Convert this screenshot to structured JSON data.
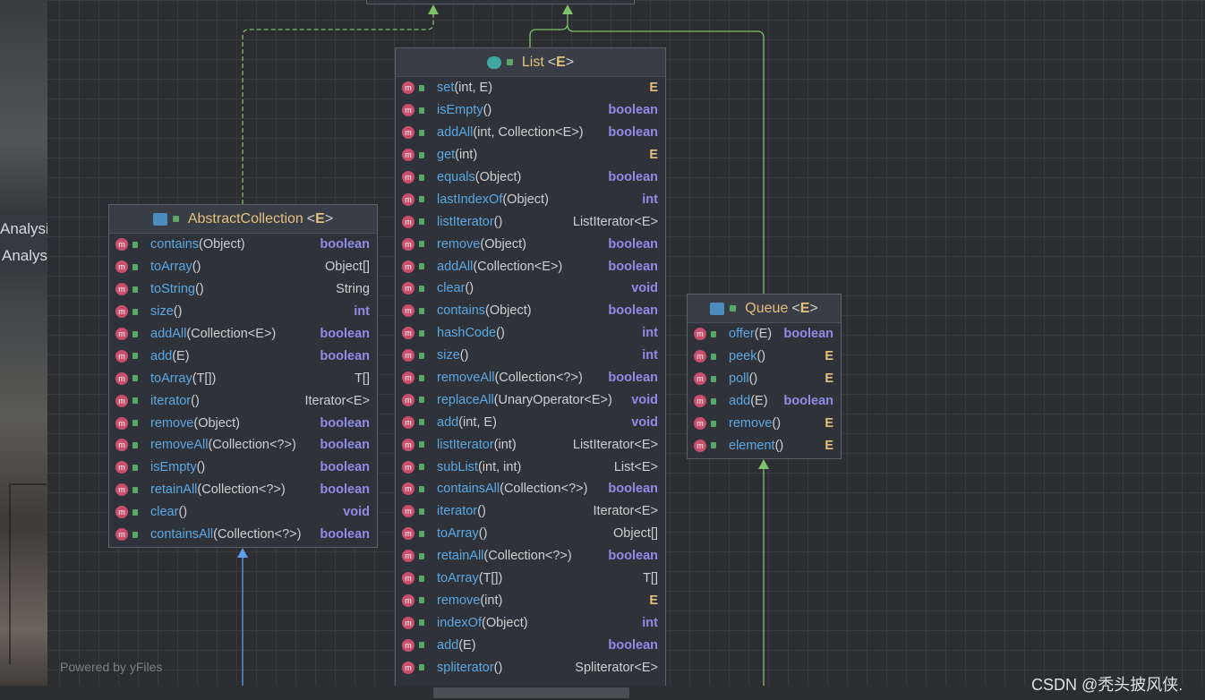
{
  "left_panel": {
    "lines": [
      "Analysi",
      "Analys"
    ]
  },
  "watermark": "Powered by yFiles",
  "credit": "CSDN @秃头披风侠.",
  "icons": {
    "method": "m-icon",
    "public": "lock-icon"
  },
  "colors": {
    "method_name": "#5aa9e6",
    "keyword": "#8f8ce8",
    "generic": "#e5c07b",
    "edge_green": "#7cc36b",
    "edge_blue": "#5aa0ee"
  },
  "nodes": {
    "abstract_collection": {
      "name": "AbstractCollection",
      "generic": "E",
      "methods": [
        {
          "name": "contains",
          "params": "(Object)",
          "type": "boolean"
        },
        {
          "name": "toArray",
          "params": "()",
          "type": "Object[]"
        },
        {
          "name": "toString",
          "params": "()",
          "type": "String"
        },
        {
          "name": "size",
          "params": "()",
          "type": "int"
        },
        {
          "name": "addAll",
          "params": "(Collection<E>)",
          "type": "boolean"
        },
        {
          "name": "add",
          "params": "(E)",
          "type": "boolean"
        },
        {
          "name": "toArray",
          "params": "(T[])",
          "type": "T[]"
        },
        {
          "name": "iterator",
          "params": "()",
          "type": "Iterator<E>"
        },
        {
          "name": "remove",
          "params": "(Object)",
          "type": "boolean"
        },
        {
          "name": "removeAll",
          "params": "(Collection<?>)",
          "type": "boolean"
        },
        {
          "name": "isEmpty",
          "params": "()",
          "type": "boolean"
        },
        {
          "name": "retainAll",
          "params": "(Collection<?>)",
          "type": "boolean"
        },
        {
          "name": "clear",
          "params": "()",
          "type": "void"
        },
        {
          "name": "containsAll",
          "params": "(Collection<?>)",
          "type": "boolean"
        }
      ]
    },
    "list": {
      "name": "List",
      "generic": "E",
      "methods": [
        {
          "name": "set",
          "params": "(int, E)",
          "type": "E"
        },
        {
          "name": "isEmpty",
          "params": "()",
          "type": "boolean"
        },
        {
          "name": "addAll",
          "params": "(int, Collection<E>)",
          "type": "boolean"
        },
        {
          "name": "get",
          "params": "(int)",
          "type": "E"
        },
        {
          "name": "equals",
          "params": "(Object)",
          "type": "boolean"
        },
        {
          "name": "lastIndexOf",
          "params": "(Object)",
          "type": "int"
        },
        {
          "name": "listIterator",
          "params": "()",
          "type": "ListIterator<E>"
        },
        {
          "name": "remove",
          "params": "(Object)",
          "type": "boolean"
        },
        {
          "name": "addAll",
          "params": "(Collection<E>)",
          "type": "boolean"
        },
        {
          "name": "clear",
          "params": "()",
          "type": "void"
        },
        {
          "name": "contains",
          "params": "(Object)",
          "type": "boolean"
        },
        {
          "name": "hashCode",
          "params": "()",
          "type": "int"
        },
        {
          "name": "size",
          "params": "()",
          "type": "int"
        },
        {
          "name": "removeAll",
          "params": "(Collection<?>)",
          "type": "boolean"
        },
        {
          "name": "replaceAll",
          "params": "(UnaryOperator<E>)",
          "type": "void"
        },
        {
          "name": "add",
          "params": "(int, E)",
          "type": "void"
        },
        {
          "name": "listIterator",
          "params": "(int)",
          "type": "ListIterator<E>"
        },
        {
          "name": "subList",
          "params": "(int, int)",
          "type": "List<E>"
        },
        {
          "name": "containsAll",
          "params": "(Collection<?>)",
          "type": "boolean"
        },
        {
          "name": "iterator",
          "params": "()",
          "type": "Iterator<E>"
        },
        {
          "name": "toArray",
          "params": "()",
          "type": "Object[]"
        },
        {
          "name": "retainAll",
          "params": "(Collection<?>)",
          "type": "boolean"
        },
        {
          "name": "toArray",
          "params": "(T[])",
          "type": "T[]"
        },
        {
          "name": "remove",
          "params": "(int)",
          "type": "E"
        },
        {
          "name": "indexOf",
          "params": "(Object)",
          "type": "int"
        },
        {
          "name": "add",
          "params": "(E)",
          "type": "boolean"
        },
        {
          "name": "spliterator",
          "params": "()",
          "type": "Spliterator<E>"
        }
      ]
    },
    "queue": {
      "name": "Queue",
      "generic": "E",
      "methods": [
        {
          "name": "offer",
          "params": "(E)",
          "type": "boolean"
        },
        {
          "name": "peek",
          "params": "()",
          "type": "E"
        },
        {
          "name": "poll",
          "params": "()",
          "type": "E"
        },
        {
          "name": "add",
          "params": "(E)",
          "type": "boolean"
        },
        {
          "name": "remove",
          "params": "()",
          "type": "E"
        },
        {
          "name": "element",
          "params": "()",
          "type": "E"
        }
      ]
    }
  }
}
